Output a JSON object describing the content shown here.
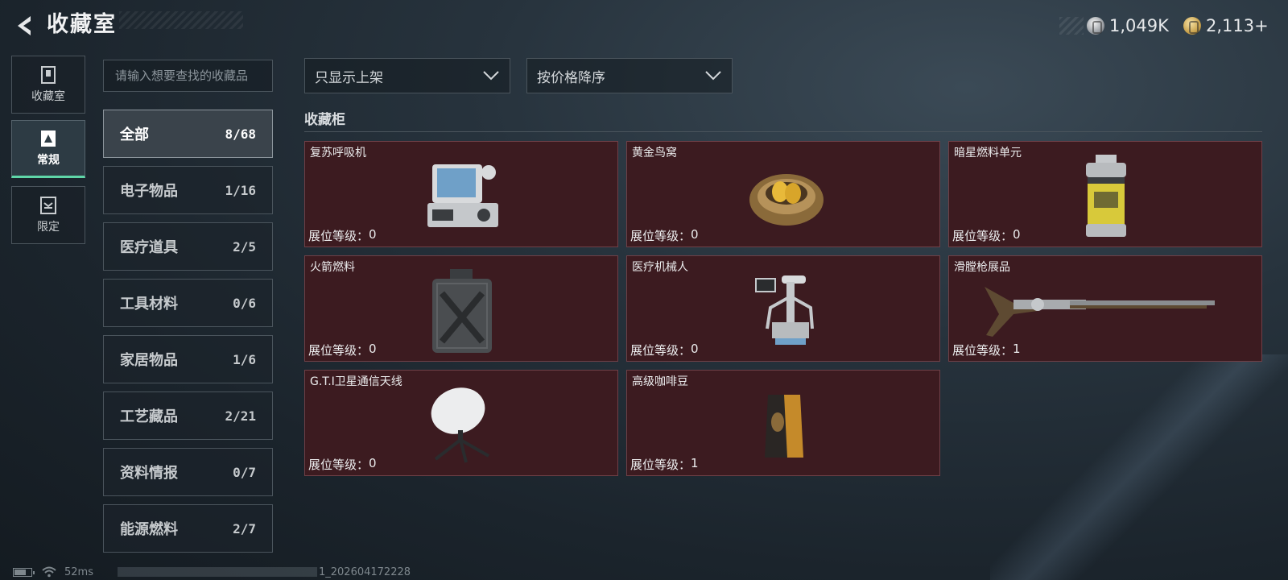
{
  "header": {
    "title": "收藏室",
    "currency_silver": "1,049K",
    "currency_gold": "2,113+"
  },
  "nav": [
    {
      "label": "收藏室",
      "icon": "trophy-cabinet-icon",
      "active": false
    },
    {
      "label": "常规",
      "icon": "regular-collection-icon",
      "active": true
    },
    {
      "label": "限定",
      "icon": "limited-collection-icon",
      "active": false
    }
  ],
  "search": {
    "placeholder": "请输入想要查找的收藏品"
  },
  "categories": [
    {
      "name": "全部",
      "count": "8/68",
      "active": true
    },
    {
      "name": "电子物品",
      "count": "1/16"
    },
    {
      "name": "医疗道具",
      "count": "2/5"
    },
    {
      "name": "工具材料",
      "count": "0/6"
    },
    {
      "name": "家居物品",
      "count": "1/6"
    },
    {
      "name": "工艺藏品",
      "count": "2/21"
    },
    {
      "name": "资料情报",
      "count": "0/7"
    },
    {
      "name": "能源燃料",
      "count": "2/7"
    }
  ],
  "filters": {
    "shelf_filter": "只显示上架",
    "sort_order": "按价格降序"
  },
  "section": {
    "title": "收藏柜"
  },
  "level_prefix": "展位等级：",
  "items": [
    {
      "name": "复苏呼吸机",
      "level": "0",
      "icon": "ventilator-icon"
    },
    {
      "name": "黄金鸟窝",
      "level": "0",
      "icon": "golden-nest-icon"
    },
    {
      "name": "暗星燃料单元",
      "level": "0",
      "icon": "fuel-cell-icon"
    },
    {
      "name": "火箭燃料",
      "level": "0",
      "icon": "jerry-can-icon"
    },
    {
      "name": "医疗机械人",
      "level": "0",
      "icon": "medical-robot-icon"
    },
    {
      "name": "滑膛枪展品",
      "level": "1",
      "icon": "musket-icon"
    },
    {
      "name": "G.T.I卫星通信天线",
      "level": "0",
      "icon": "satellite-dish-icon"
    },
    {
      "name": "高级咖啡豆",
      "level": "1",
      "icon": "coffee-bag-icon"
    }
  ],
  "footer": {
    "ping": "52ms",
    "build": "1_202604172228"
  },
  "colors": {
    "accent_green": "#5fd6a8",
    "card_bg": "#3c1b20",
    "card_border": "#6f4047"
  }
}
